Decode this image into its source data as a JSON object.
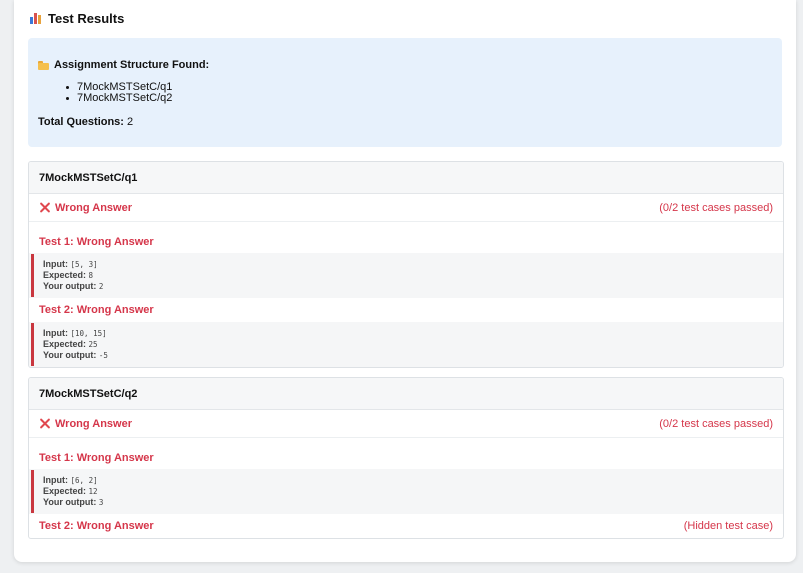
{
  "header": {
    "icon": "bar-chart-icon",
    "title": "Test Results"
  },
  "structure": {
    "icon": "folder-icon",
    "heading": "Assignment Structure Found:",
    "items": [
      "7MockMSTSetC/q1",
      "7MockMSTSetC/q2"
    ],
    "total_label": "Total Questions:",
    "total_value": "2"
  },
  "questions": [
    {
      "name": "7MockMSTSetC/q1",
      "status": "Wrong Answer",
      "summary": "(0/2 test cases passed)",
      "tests": [
        {
          "title": "Test 1: Wrong Answer",
          "input_label": "Input:",
          "input": "[5, 3]",
          "expected_label": "Expected:",
          "expected": "8",
          "output_label": "Your output:",
          "output": "2"
        },
        {
          "title": "Test 2: Wrong Answer",
          "input_label": "Input:",
          "input": "[10, 15]",
          "expected_label": "Expected:",
          "expected": "25",
          "output_label": "Your output:",
          "output": "-5"
        }
      ]
    },
    {
      "name": "7MockMSTSetC/q2",
      "status": "Wrong Answer",
      "summary": "(0/2 test cases passed)",
      "tests": [
        {
          "title": "Test 1: Wrong Answer",
          "input_label": "Input:",
          "input": "[6, 2]",
          "expected_label": "Expected:",
          "expected": "12",
          "output_label": "Your output:",
          "output": "3"
        },
        {
          "title": "Test 2: Wrong Answer",
          "note": "(Hidden test case)"
        }
      ]
    }
  ],
  "colors": {
    "error": "#d5364a",
    "info_bg": "#e7f1fc",
    "accent_bar": "#c9373f"
  }
}
